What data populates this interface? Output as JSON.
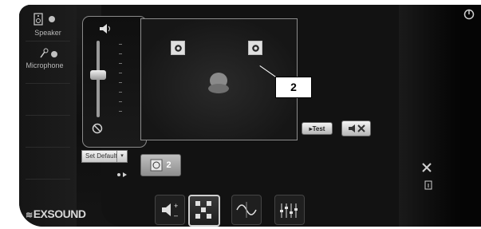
{
  "devices": [
    {
      "label": "Speaker",
      "icon": "speaker-device-icon"
    },
    {
      "label": "Microphone",
      "icon": "microphone-device-icon"
    }
  ],
  "mixer": {
    "volume_icon": "volume-icon",
    "mute_icon": "mute-icon",
    "volume_level": 0.55
  },
  "set_default": {
    "label": "Set Default"
  },
  "speaker_count": "2",
  "callout_label": "2",
  "test_button": {
    "label": "▸Test"
  },
  "brand": {
    "logo": "EXSOUND"
  },
  "tabs": [
    {
      "icon": "volume-plus-minus-icon",
      "active": false
    },
    {
      "icon": "speaker-layout-icon",
      "active": true
    },
    {
      "icon": "waveform-icon",
      "active": false
    },
    {
      "icon": "equalizer-icon",
      "active": false
    }
  ],
  "colors": {
    "panel": "#121212",
    "border": "#8c8c8c",
    "button": "#d9d9d9"
  }
}
